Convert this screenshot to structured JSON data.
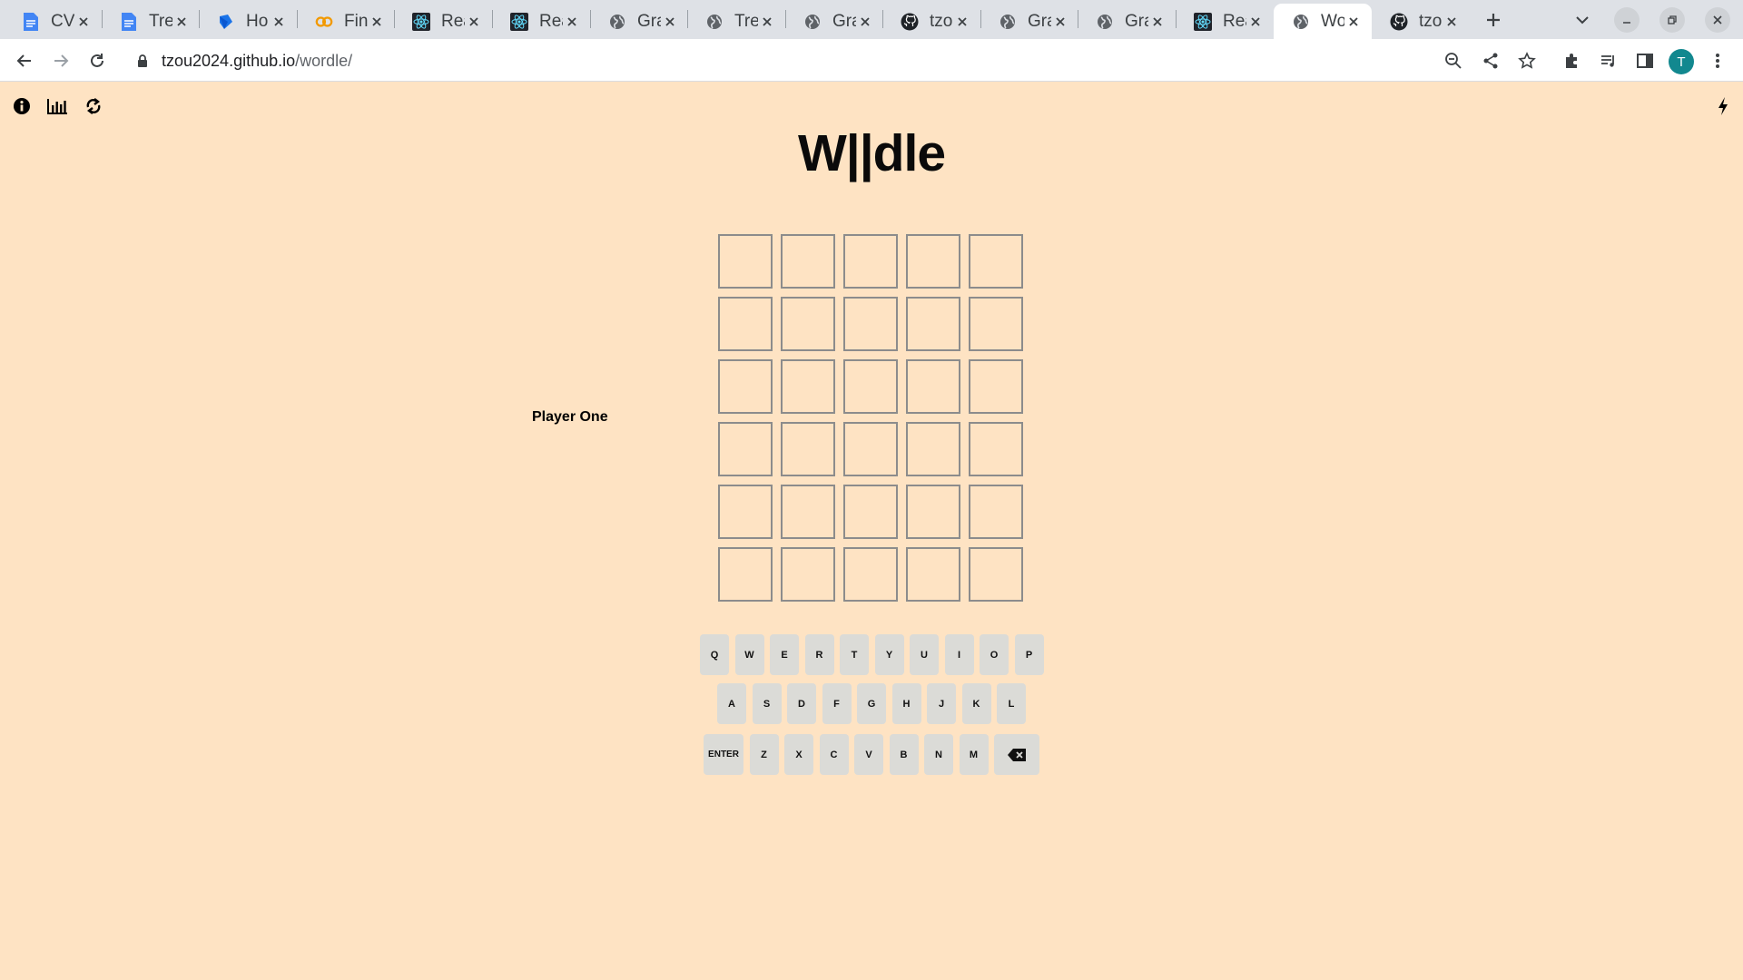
{
  "browser": {
    "tabs": [
      {
        "title": "CV",
        "icon": "google-docs-icon",
        "active": false
      },
      {
        "title": "Tre",
        "icon": "google-docs-icon",
        "active": false
      },
      {
        "title": "Ho",
        "icon": "blue-tag-icon",
        "active": false
      },
      {
        "title": "Fin",
        "icon": "orange-link-icon",
        "active": false
      },
      {
        "title": "Rea",
        "icon": "react-icon",
        "active": false
      },
      {
        "title": "Rea",
        "icon": "react-icon",
        "active": false
      },
      {
        "title": "Gra",
        "icon": "globe-icon",
        "active": false
      },
      {
        "title": "Tre",
        "icon": "globe-icon",
        "active": false
      },
      {
        "title": "Gra",
        "icon": "globe-icon",
        "active": false
      },
      {
        "title": "tzo",
        "icon": "github-icon",
        "active": false
      },
      {
        "title": "Gra",
        "icon": "globe-icon",
        "active": false
      },
      {
        "title": "Gra",
        "icon": "globe-icon",
        "active": false
      },
      {
        "title": "Rea",
        "icon": "react-icon",
        "active": false
      },
      {
        "title": "Wo",
        "icon": "globe-icon",
        "active": true
      },
      {
        "title": "tzo",
        "icon": "github-icon",
        "active": false
      }
    ],
    "url_host": "tzou2024.github.io",
    "url_path": "/wordle/",
    "profile_initial": "T",
    "profile_color": "#12888f"
  },
  "page": {
    "background": "#fee3c3",
    "title": "W||dle",
    "player_label": "Player One",
    "header_icons": [
      "info-icon",
      "chart-icon",
      "swap-icon",
      "bolt-icon"
    ]
  },
  "board": {
    "rows": 6,
    "cols": 5,
    "tiles": [
      [
        "",
        "",
        "",
        "",
        ""
      ],
      [
        "",
        "",
        "",
        "",
        ""
      ],
      [
        "",
        "",
        "",
        "",
        ""
      ],
      [
        "",
        "",
        "",
        "",
        ""
      ],
      [
        "",
        "",
        "",
        "",
        ""
      ],
      [
        "",
        "",
        "",
        "",
        ""
      ]
    ]
  },
  "keyboard": {
    "row1": [
      "Q",
      "W",
      "E",
      "R",
      "T",
      "Y",
      "U",
      "I",
      "O",
      "P"
    ],
    "row2": [
      "A",
      "S",
      "D",
      "F",
      "G",
      "H",
      "J",
      "K",
      "L"
    ],
    "row3": [
      "ENTER",
      "Z",
      "X",
      "C",
      "V",
      "B",
      "N",
      "M",
      "⌫"
    ],
    "key_color": "#dbdbd7"
  }
}
